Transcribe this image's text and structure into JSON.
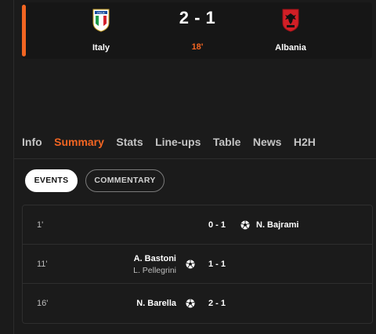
{
  "match": {
    "home_team": "Italy",
    "away_team": "Albania",
    "score": "2 - 1",
    "minute": "18'",
    "accent_color": "#f26522",
    "home_crest_icon": "italy-crest-icon",
    "away_crest_icon": "albania-crest-icon"
  },
  "tabs": [
    {
      "label": "Info",
      "active": false
    },
    {
      "label": "Summary",
      "active": true
    },
    {
      "label": "Stats",
      "active": false
    },
    {
      "label": "Line-ups",
      "active": false
    },
    {
      "label": "Table",
      "active": false
    },
    {
      "label": "News",
      "active": false
    },
    {
      "label": "H2H",
      "active": false
    }
  ],
  "filters": {
    "events_label": "EVENTS",
    "commentary_label": "COMMENTARY",
    "selected": "EVENTS"
  },
  "events": [
    {
      "minute": "1'",
      "side": "away",
      "player": "N. Bajrami",
      "assist": "",
      "score": "0 - 1",
      "icon": "football-icon"
    },
    {
      "minute": "11'",
      "side": "home",
      "player": "A. Bastoni",
      "assist": "L. Pellegrini",
      "score": "1 - 1",
      "icon": "football-icon"
    },
    {
      "minute": "16'",
      "side": "home",
      "player": "N. Barella",
      "assist": "",
      "score": "2 - 1",
      "icon": "football-icon"
    }
  ]
}
